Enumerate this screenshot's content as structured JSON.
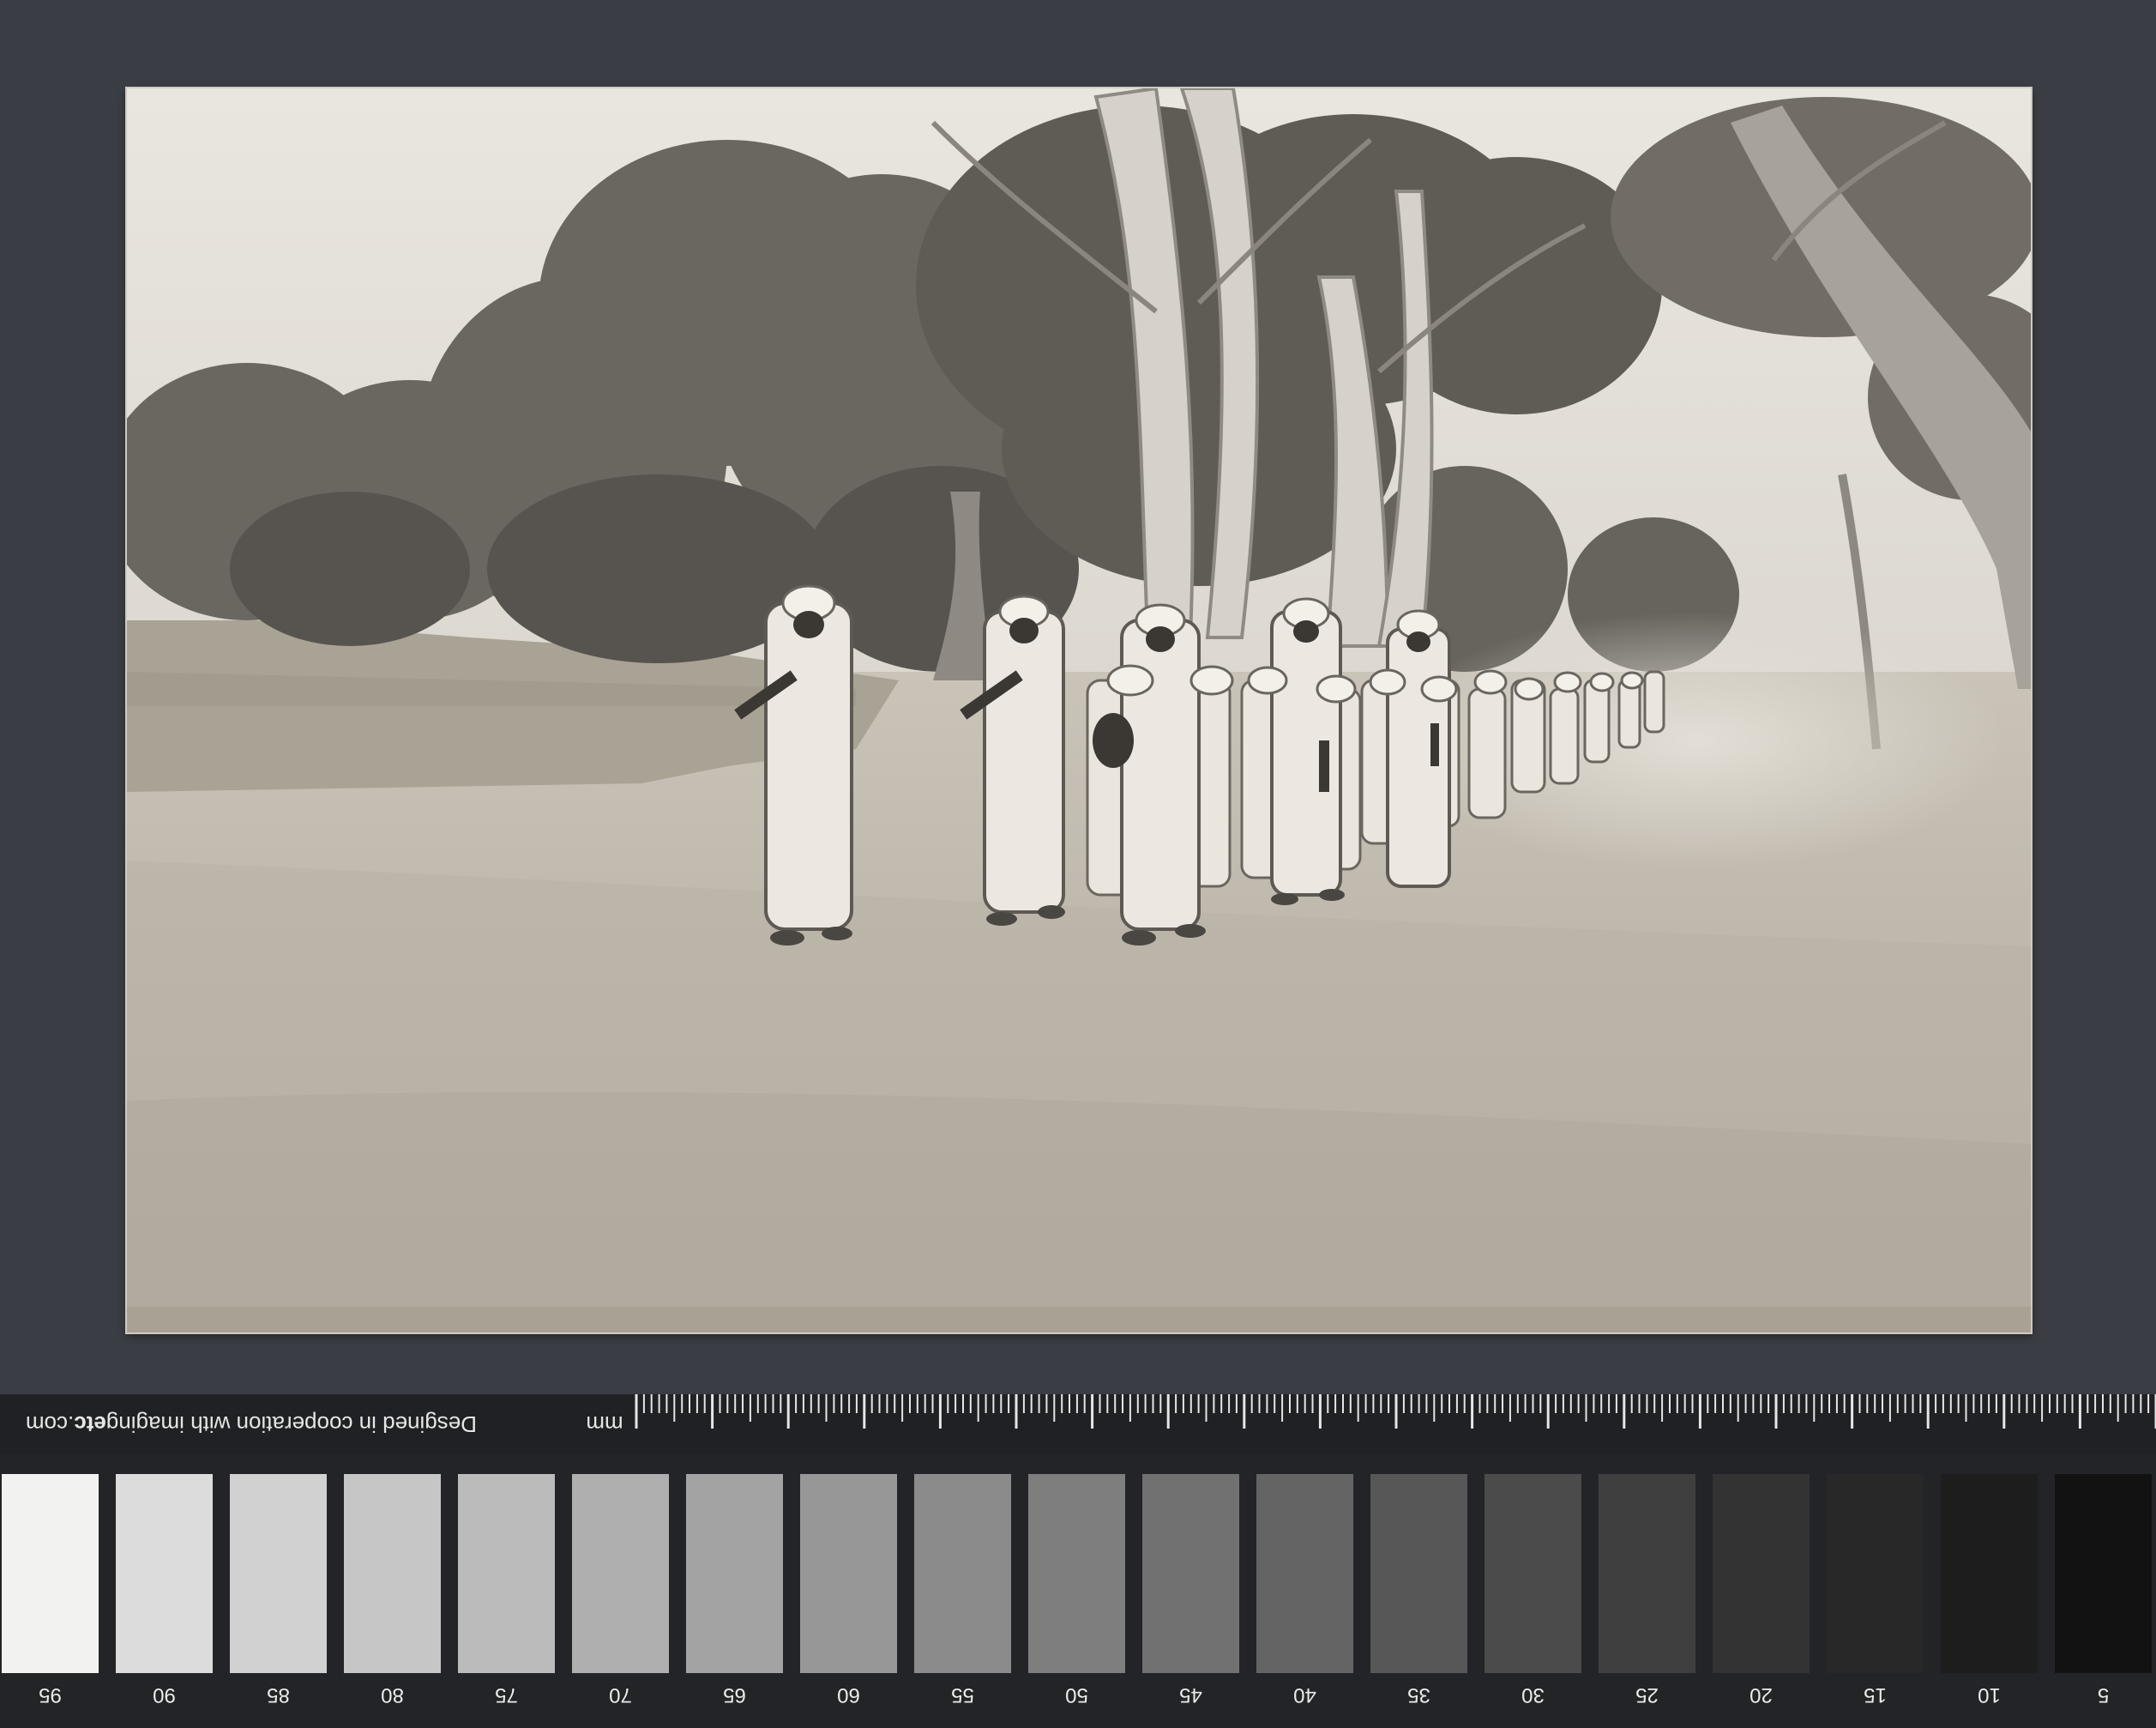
{
  "photo": {
    "subject": "marching-soldiers"
  },
  "target": {
    "credit_prefix": "Desgined in cooperation with imaging",
    "credit_bold": "etc",
    "credit_suffix": ".com",
    "unit_label": "mm",
    "patches": [
      {
        "label": "95",
        "color": "#f2f2f0"
      },
      {
        "label": "90",
        "color": "#dcdcdc"
      },
      {
        "label": "85",
        "color": "#d1d1d1"
      },
      {
        "label": "80",
        "color": "#c6c6c6"
      },
      {
        "label": "75",
        "color": "#bbbbbb"
      },
      {
        "label": "70",
        "color": "#afafaf"
      },
      {
        "label": "65",
        "color": "#a3a3a3"
      },
      {
        "label": "60",
        "color": "#979797"
      },
      {
        "label": "55",
        "color": "#8b8b8b"
      },
      {
        "label": "50",
        "color": "#7e7e7e"
      },
      {
        "label": "45",
        "color": "#717171"
      },
      {
        "label": "40",
        "color": "#646464"
      },
      {
        "label": "35",
        "color": "#575757"
      },
      {
        "label": "30",
        "color": "#4b4b4b"
      },
      {
        "label": "25",
        "color": "#3f3f3f"
      },
      {
        "label": "20",
        "color": "#333333"
      },
      {
        "label": "15",
        "color": "#282828"
      },
      {
        "label": "10",
        "color": "#1d1d1d"
      },
      {
        "label": "5",
        "color": "#121212"
      }
    ]
  }
}
